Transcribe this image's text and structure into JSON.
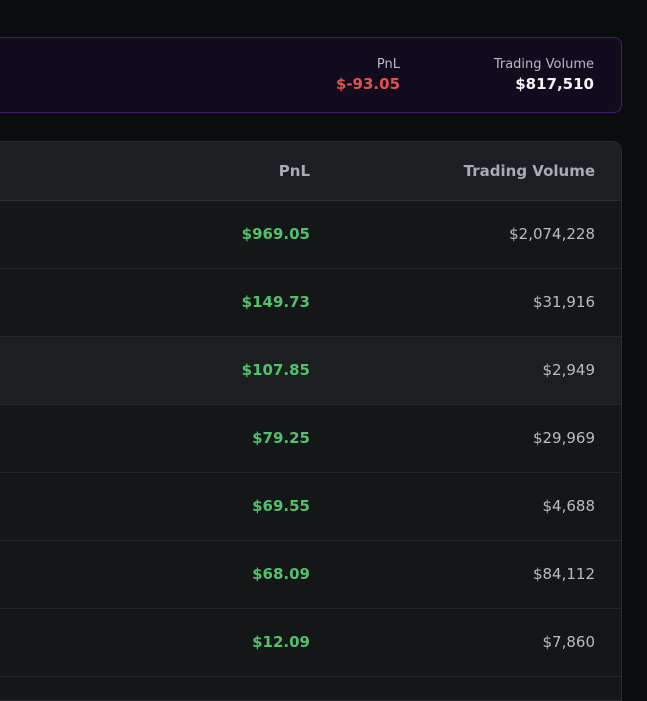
{
  "summary": {
    "pnl_label": "PnL",
    "pnl_value": "$-93.05",
    "volume_label": "Trading Volume",
    "volume_value": "$817,510"
  },
  "table": {
    "columns": [
      "PnL",
      "Trading Volume"
    ],
    "rows": [
      {
        "pnl": "$969.05",
        "volume": "$2,074,228"
      },
      {
        "pnl": "$149.73",
        "volume": "$31,916"
      },
      {
        "pnl": "$107.85",
        "volume": "$2,949"
      },
      {
        "pnl": "$79.25",
        "volume": "$29,969"
      },
      {
        "pnl": "$69.55",
        "volume": "$4,688"
      },
      {
        "pnl": "$68.09",
        "volume": "$84,112"
      },
      {
        "pnl": "$12.09",
        "volume": "$7,860"
      }
    ]
  },
  "colors": {
    "positive": "#52c26a",
    "negative": "#e05252",
    "accent_border": "#3e1f6b"
  }
}
